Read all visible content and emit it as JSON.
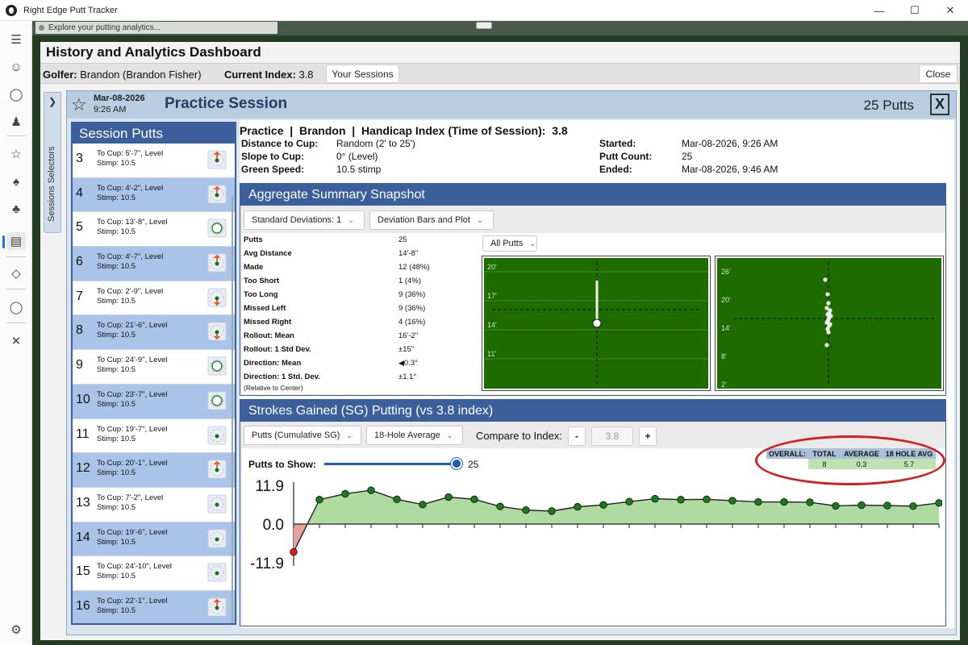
{
  "window": {
    "title": "Right Edge Putt Tracker"
  },
  "hint": "Explore your putting analytics...",
  "dashboard": {
    "title": "History and Analytics Dashboard",
    "golfer_label": "Golfer:",
    "golfer_value": "Brandon (Brandon Fisher)",
    "index_label": "Current Index:",
    "index_value": "3.8",
    "your_sessions": "Your Sessions",
    "close": "Close"
  },
  "sidetab": {
    "label": "Sessions Selectors"
  },
  "session": {
    "date": "Mar-08-2026",
    "time": "9:26 AM",
    "title": "Practice Session",
    "putts": "25 Putts",
    "close": "X",
    "summary_line": "Practice  |  Brandon  |  Handicap Index (Time of Session):  3.8",
    "details_left": [
      {
        "k": "Distance to Cup:",
        "v": "Random (2' to 25')"
      },
      {
        "k": "Slope to Cup:",
        "v": "0° (Level)"
      },
      {
        "k": "Green Speed:",
        "v": "10.5 stimp"
      }
    ],
    "details_right": [
      {
        "k": "Started:",
        "v": "Mar-08-2026, 9:26 AM"
      },
      {
        "k": "Putt Count:",
        "v": "25"
      },
      {
        "k": "Ended:",
        "v": "Mar-08-2026, 9:46 AM"
      }
    ]
  },
  "putt_list": {
    "title": "Session Putts",
    "items": [
      {
        "n": "3",
        "l1": "To Cup: 5'-7\", Level",
        "l2": "Stimp: 10.5",
        "icon": "arrow-up-icon"
      },
      {
        "n": "4",
        "l1": "To Cup: 4'-2\", Level",
        "l2": "Stimp: 10.5",
        "icon": "arrow-up-icon"
      },
      {
        "n": "5",
        "l1": "To Cup: 13'-8\", Level",
        "l2": "Stimp: 10.5",
        "icon": "made-circle-icon"
      },
      {
        "n": "6",
        "l1": "To Cup: 4'-7\", Level",
        "l2": "Stimp: 10.5",
        "icon": "arrow-up-icon"
      },
      {
        "n": "7",
        "l1": "To Cup: 2'-9\", Level",
        "l2": "Stimp: 10.5",
        "icon": "arrow-down-icon"
      },
      {
        "n": "8",
        "l1": "To Cup: 21'-6\", Level",
        "l2": "Stimp: 10.5",
        "icon": "arrow-down-icon"
      },
      {
        "n": "9",
        "l1": "To Cup: 24'-9\", Level",
        "l2": "Stimp: 10.5",
        "icon": "made-circle-icon"
      },
      {
        "n": "10",
        "l1": "To Cup: 23'-7\", Level",
        "l2": "Stimp: 10.5",
        "icon": "made-circle-icon"
      },
      {
        "n": "11",
        "l1": "To Cup: 19'-7\", Level",
        "l2": "Stimp: 10.5",
        "icon": "dot-icon"
      },
      {
        "n": "12",
        "l1": "To Cup: 20'-1\", Level",
        "l2": "Stimp: 10.5",
        "icon": "arrow-up-icon"
      },
      {
        "n": "13",
        "l1": "To Cup: 7'-2\", Level",
        "l2": "Stimp: 10.5",
        "icon": "dot-icon"
      },
      {
        "n": "14",
        "l1": "To Cup: 19'-6\", Level",
        "l2": "Stimp: 10.5",
        "icon": "dot-icon"
      },
      {
        "n": "15",
        "l1": "To Cup: 24'-10\", Level",
        "l2": "Stimp: 10.5",
        "icon": "dot-icon"
      },
      {
        "n": "16",
        "l1": "To Cup: 22'-1\", Level",
        "l2": "Stimp: 10.5",
        "icon": "arrow-up-icon"
      }
    ]
  },
  "aggregate": {
    "title": "Aggregate Summary Snapshot",
    "std_select": "Standard Deviations: 1",
    "view_select": "Deviation Bars and Plot",
    "filter_select": "All Putts",
    "stats": [
      {
        "k": "Putts",
        "v": "25"
      },
      {
        "k": "Avg Distance",
        "v": "14'-8\""
      },
      {
        "k": "Made",
        "v": "12 (48%)"
      },
      {
        "k": "Too Short",
        "v": "1 (4%)"
      },
      {
        "k": "Too Long",
        "v": "9 (36%)"
      },
      {
        "k": "Missed Left",
        "v": "9 (36%)"
      },
      {
        "k": "Missed Right",
        "v": "4 (16%)"
      },
      {
        "k": "Rollout: Mean",
        "v": "16'-2\""
      },
      {
        "k": "Rollout: 1 Std Dev.",
        "v": "±15\""
      },
      {
        "k": "Direction: Mean",
        "v": "0.3°"
      },
      {
        "k": "Direction: 1 Std. Dev.",
        "v": "±1.1°"
      }
    ],
    "relative_note": "(Relative to Center)",
    "green1_labels": [
      "20'",
      "17'",
      "14'",
      "11'"
    ],
    "green2_labels": [
      "26'",
      "20'",
      "14'",
      "8'",
      "2'"
    ]
  },
  "sg": {
    "title": "Strokes Gained (SG) Putting (vs 3.8 index)",
    "mode_select": "Putts (Cumulative SG)",
    "avg_select": "18-Hole Average",
    "compare_label": "Compare to Index:",
    "minus": "-",
    "index_value": "3.8",
    "plus": "+",
    "putts_to_show_label": "Putts to Show:",
    "putts_to_show_value": "25",
    "slider_fraction": 1.0,
    "table": {
      "overall": "OVERALL:",
      "total_h": "TOTAL",
      "avg_h": "AVERAGE",
      "h18_h": "18 HOLE AVG",
      "total": "8",
      "avg": "0.3",
      "h18": "5.7"
    }
  },
  "chart_data": {
    "type": "area",
    "title": "",
    "xlabel": "",
    "ylabel": "",
    "ylim": [
      -11.9,
      11.9
    ],
    "y_ticks": [
      "11.9",
      "0.0",
      "-11.9"
    ],
    "x": [
      0,
      1,
      2,
      3,
      4,
      5,
      6,
      7,
      8,
      9,
      10,
      11,
      12,
      13,
      14,
      15,
      16,
      17,
      18,
      19,
      20,
      21,
      22,
      23,
      24,
      25
    ],
    "values": [
      -8.6,
      7.5,
      9.3,
      10.4,
      7.6,
      6.0,
      8.3,
      7.6,
      5.4,
      4.3,
      4.0,
      5.3,
      5.9,
      6.9,
      7.8,
      7.5,
      7.6,
      7.2,
      6.8,
      6.8,
      6.7,
      5.6,
      5.8,
      5.7,
      5.5,
      6.5
    ],
    "colors": {
      "fill": "#b0dba0",
      "line": "#222222",
      "point": "#1e7a1e",
      "negative_point": "#d82020",
      "negative_fill": "#e8a0a0"
    }
  },
  "colors": {
    "accent": "#3a5f9a",
    "green": "#1e6b00",
    "highlight": "#d21f1f"
  }
}
